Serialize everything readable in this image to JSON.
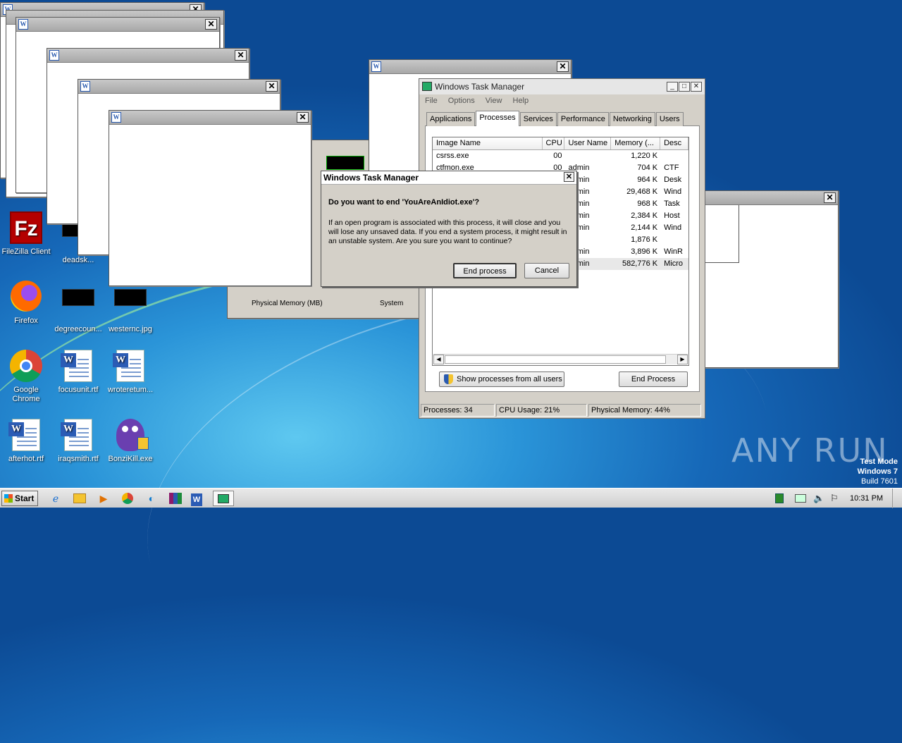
{
  "desktop": {
    "icons": [
      {
        "label": "FileZilla Client",
        "kind": "filezilla-icon"
      },
      {
        "label": "deadsk...",
        "kind": "black-thumb-icon"
      },
      {
        "label": "Firefox",
        "kind": "firefox-icon"
      },
      {
        "label": "degreecoun...",
        "kind": "black-thumb-icon"
      },
      {
        "label": "westernc.jpg",
        "kind": "black-thumb-icon"
      },
      {
        "label": "Google Chrome",
        "kind": "chrome-icon"
      },
      {
        "label": "focusunit.rtf",
        "kind": "word-doc-icon"
      },
      {
        "label": "wroteretum...",
        "kind": "word-doc-icon"
      },
      {
        "label": "afterhot.rtf",
        "kind": "word-doc-icon"
      },
      {
        "label": "iraqsmith.rtf",
        "kind": "word-doc-icon"
      },
      {
        "label": "BonziKill.exe",
        "kind": "bonzi-icon"
      }
    ],
    "watermark": "ANY RUN",
    "testmode": {
      "line1": "Test Mode",
      "line2": "Windows 7",
      "line3": "Build 7601"
    }
  },
  "close_glyph": "✕",
  "task_manager": {
    "title": "Windows Task Manager",
    "menu": [
      "File",
      "Options",
      "View",
      "Help"
    ],
    "tabs": [
      "Applications",
      "Processes",
      "Services",
      "Performance",
      "Networking",
      "Users"
    ],
    "active_tab": "Processes",
    "columns": [
      "Image Name",
      "CPU",
      "User Name",
      "Memory (...",
      "Desc"
    ],
    "rows": [
      [
        "csrss.exe",
        "00",
        "",
        "1,220 K",
        ""
      ],
      [
        "ctfmon.exe",
        "00",
        "admin",
        "704 K",
        "CTF"
      ],
      [
        "",
        "",
        "admin",
        "964 K",
        "Desk"
      ],
      [
        "",
        "",
        "admin",
        "29,468 K",
        "Wind"
      ],
      [
        "",
        "",
        "admin",
        "968 K",
        "Task"
      ],
      [
        "",
        "",
        "admin",
        "2,384 K",
        "Host"
      ],
      [
        "",
        "",
        "admin",
        "2,144 K",
        "Wind"
      ],
      [
        "",
        "",
        "",
        "1,876 K",
        ""
      ],
      [
        "",
        "",
        "admin",
        "3,896 K",
        "WinR"
      ],
      [
        "",
        "",
        "admin",
        "582,776 K",
        "Micro"
      ]
    ],
    "show_all_label": "Show processes from all users",
    "end_process_label": "End Process",
    "status": {
      "processes": "Processes: 34",
      "cpu": "CPU Usage: 21%",
      "memory": "Physical Memory: 44%"
    }
  },
  "dialog": {
    "title": "Windows Task Manager",
    "question": "Do you want to end 'YouAreAnIdiot.exe'?",
    "body": "If an open program is associated with this process, it will close and you will lose any unsaved data. If you end a system process, it might result in an unstable system. Are you sure you want to continue?",
    "confirm_label": "End process",
    "cancel_label": "Cancel"
  },
  "behind_window": {
    "label1": "Physical Memory (MB)",
    "label2": "System"
  },
  "taskbar": {
    "start_label": "Start",
    "clock": "10:31 PM"
  }
}
